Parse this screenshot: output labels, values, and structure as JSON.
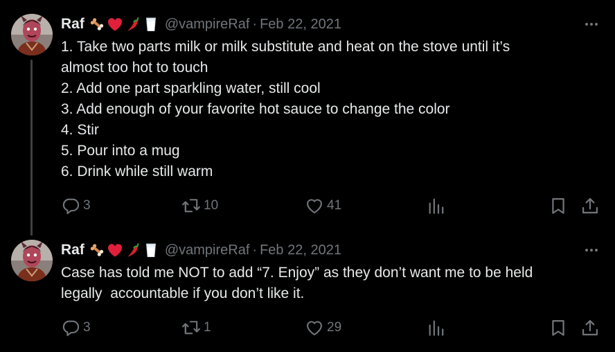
{
  "colors": {
    "background": "#000000",
    "text": "#e7e9ea",
    "muted": "#71767b",
    "thread_line": "#3d4145"
  },
  "tweets": [
    {
      "author": {
        "name": "Raf",
        "emojis": [
          "bone-emoji",
          "red-heart-emoji",
          "chili-pepper-emoji",
          "glass-of-milk-emoji"
        ],
        "handle": "@vampireRaf",
        "separator": "·",
        "date": "Feb 22, 2021"
      },
      "lines": [
        "1. Take two parts milk or milk substitute and heat on the stove until it’s",
        "almost too hot to touch",
        "2. Add one part sparkling water, still cool",
        "3. Add enough of your favorite hot sauce to change the color",
        "4. Stir",
        "5. Pour into a mug",
        "6. Drink while still warm"
      ],
      "actions": {
        "replies": "3",
        "retweets": "10",
        "likes": "41"
      },
      "icons": [
        "reply-icon",
        "retweet-icon",
        "like-icon",
        "views-icon",
        "bookmark-icon",
        "share-icon"
      ]
    },
    {
      "author": {
        "name": "Raf",
        "emojis": [
          "bone-emoji",
          "red-heart-emoji",
          "chili-pepper-emoji",
          "glass-of-milk-emoji"
        ],
        "handle": "@vampireRaf",
        "separator": "·",
        "date": "Feb 22, 2021"
      },
      "lines": [
        "Case has told me NOT to add “7. Enjoy” as they don’t want me to be held",
        "legally  accountable if you don’t like it."
      ],
      "actions": {
        "replies": "3",
        "retweets": "1",
        "likes": "29"
      },
      "icons": [
        "reply-icon",
        "retweet-icon",
        "like-icon",
        "views-icon",
        "bookmark-icon",
        "share-icon"
      ]
    }
  ]
}
